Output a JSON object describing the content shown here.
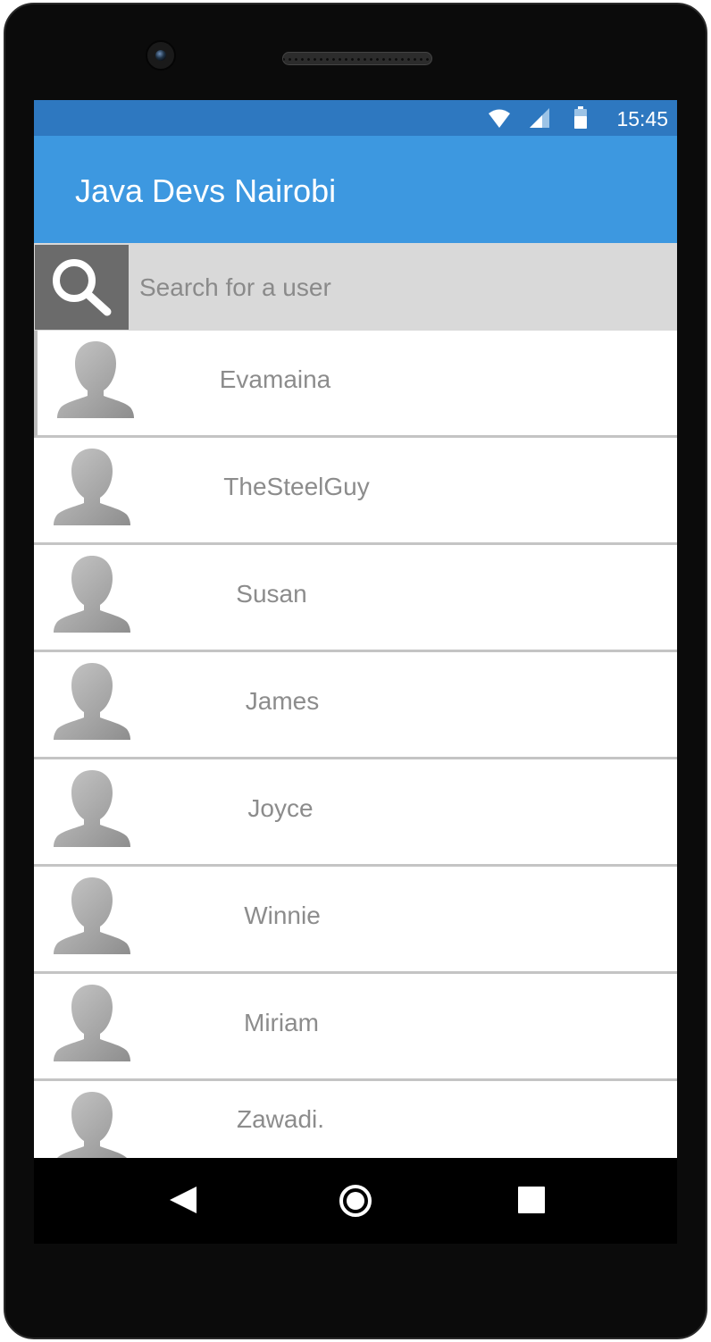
{
  "status_bar": {
    "time": "15:45",
    "icons": [
      "wifi-icon",
      "cell-signal-icon",
      "battery-icon"
    ]
  },
  "app_bar": {
    "title": "Java Devs Nairobi",
    "color": "#3d98e0"
  },
  "search": {
    "placeholder": "Search for a user",
    "value": "",
    "icon": "search-icon"
  },
  "users": [
    {
      "name": "Evamaina"
    },
    {
      "name": "TheSteelGuy"
    },
    {
      "name": "Susan"
    },
    {
      "name": "James"
    },
    {
      "name": "Joyce"
    },
    {
      "name": "Winnie"
    },
    {
      "name": "Miriam"
    },
    {
      "name": "Zawadi."
    }
  ],
  "navigation": {
    "buttons": [
      "back-icon",
      "home-icon",
      "recent-apps-icon"
    ]
  },
  "colors": {
    "status_bar": "#2e78c0",
    "app_bar": "#3d98e0",
    "search_bar": "#d9d9d9",
    "search_button": "#6b6b6b",
    "text_muted": "#8c8c8c"
  }
}
